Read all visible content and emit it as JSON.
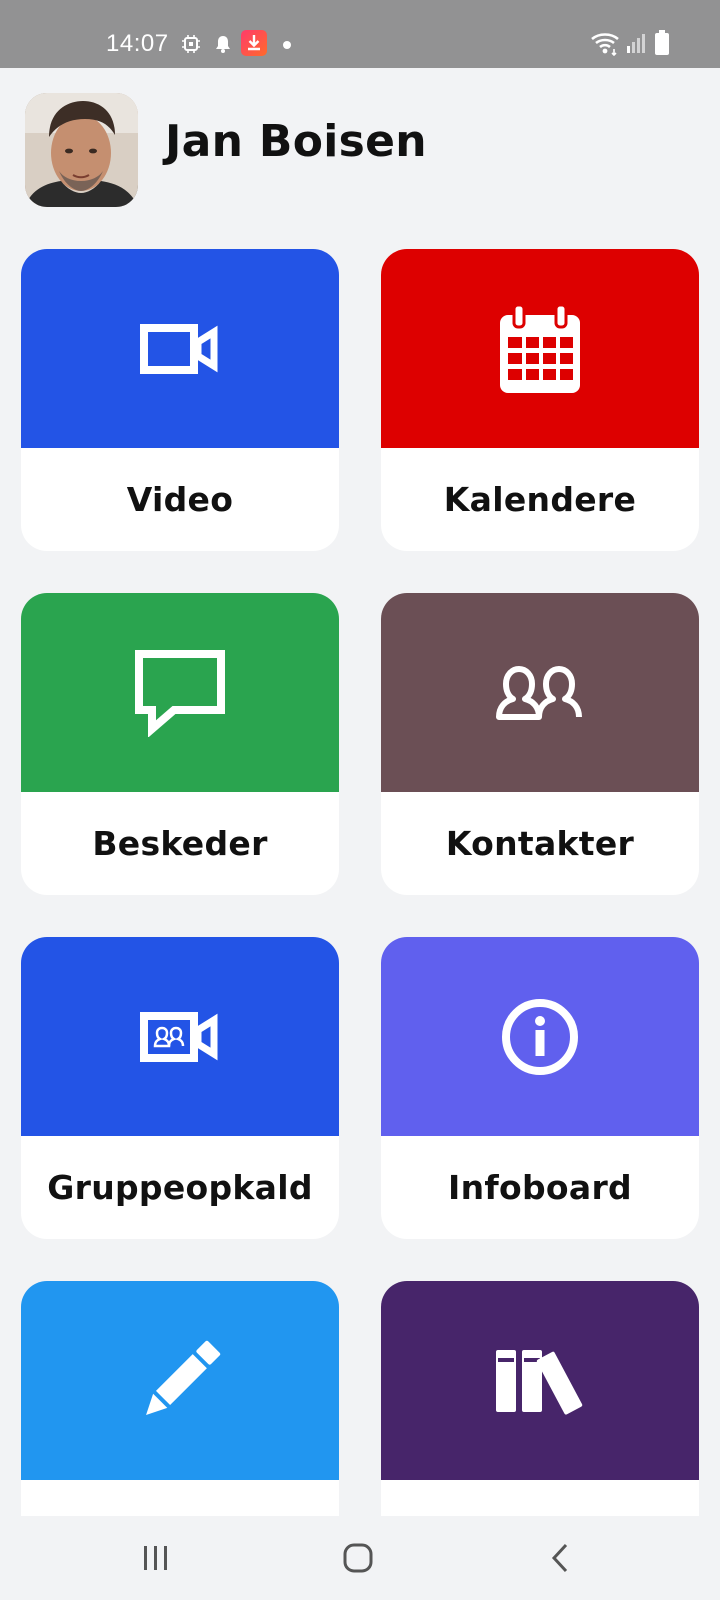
{
  "status_bar": {
    "time": "14:07",
    "icons": [
      "chip-icon",
      "bell-icon",
      "download-app-icon",
      "dot-icon",
      "wifi-icon",
      "signal-icon",
      "battery-icon"
    ]
  },
  "header": {
    "user_name": "Jan Boisen",
    "avatar": "user-avatar-photo"
  },
  "tiles": [
    {
      "label": "Video",
      "color": "#2354e6",
      "icon": "video-camera-icon"
    },
    {
      "label": "Kalendere",
      "color": "#dd0000",
      "icon": "calendar-icon"
    },
    {
      "label": "Beskeder",
      "color": "#2aa44f",
      "icon": "chat-bubble-icon"
    },
    {
      "label": "Kontakter",
      "color": "#6b4f55",
      "icon": "contacts-icon"
    },
    {
      "label": "Gruppeopkald",
      "color": "#2354e6",
      "icon": "group-video-icon"
    },
    {
      "label": "Infoboard",
      "color": "#6060ee",
      "icon": "info-icon"
    },
    {
      "label": "",
      "color": "#2196f0",
      "icon": "pencil-icon"
    },
    {
      "label": "",
      "color": "#47256a",
      "icon": "books-icon"
    }
  ],
  "nav_bar": {
    "buttons": [
      "recent-apps-icon",
      "home-icon",
      "back-icon"
    ]
  }
}
